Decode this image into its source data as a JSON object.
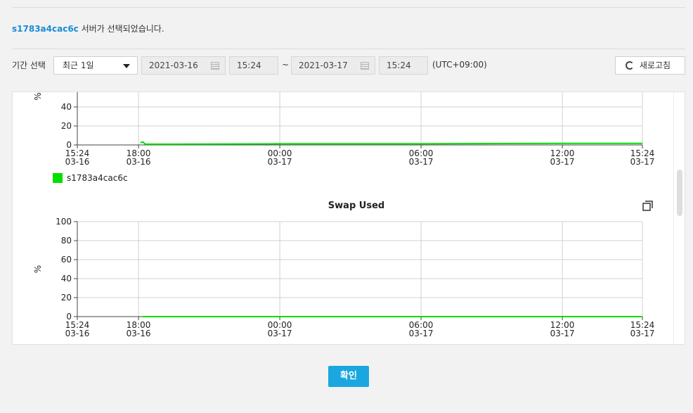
{
  "server_notice": {
    "server": "s1783a4cac6c",
    "text": "서버가 선택되었습니다."
  },
  "toolbar": {
    "period_label": "기간 선택",
    "period_select": "최근 1일",
    "start_date": "2021-03-16",
    "start_time": "15:24",
    "separator": "~",
    "end_date": "2021-03-17",
    "end_time": "15:24",
    "timezone": "(UTC+09:00)",
    "refresh_label": "새로고침"
  },
  "x_ticks": [
    {
      "time": "15:24",
      "date": "03-16"
    },
    {
      "time": "18:00",
      "date": "03-16"
    },
    {
      "time": "00:00",
      "date": "03-17"
    },
    {
      "time": "06:00",
      "date": "03-17"
    },
    {
      "time": "12:00",
      "date": "03-17"
    },
    {
      "time": "15:24",
      "date": "03-17"
    }
  ],
  "chart_data": [
    {
      "type": "line",
      "title": "",
      "ylabel": "%",
      "ylim": [
        0,
        100
      ],
      "y_ticks_visible": [
        "40",
        "20",
        "0"
      ],
      "legend": [
        {
          "name": "s1783a4cac6c",
          "color": "#00e000"
        }
      ],
      "series": [
        {
          "name": "s1783a4cac6c",
          "color": "#00e000",
          "points": [
            [
              "2021-03-16 18:05",
              2.5
            ],
            [
              "2021-03-16 18:12",
              3.0
            ],
            [
              "2021-03-16 18:17",
              0.8
            ],
            [
              "2021-03-16 21:00",
              0.9
            ],
            [
              "2021-03-17 00:00",
              1.2
            ],
            [
              "2021-03-17 06:00",
              1.2
            ],
            [
              "2021-03-17 12:00",
              1.6
            ],
            [
              "2021-03-17 15:24",
              1.6
            ]
          ]
        }
      ]
    },
    {
      "type": "line",
      "title": "Swap Used",
      "ylabel": "%",
      "ylim": [
        0,
        100
      ],
      "y_ticks": [
        "100",
        "80",
        "60",
        "40",
        "20",
        "0"
      ],
      "series": [
        {
          "name": "s1783a4cac6c",
          "color": "#00e000",
          "points": [
            [
              "2021-03-16 18:10",
              0
            ],
            [
              "2021-03-17 15:24",
              0
            ]
          ]
        }
      ]
    }
  ],
  "confirm_label": "확인"
}
